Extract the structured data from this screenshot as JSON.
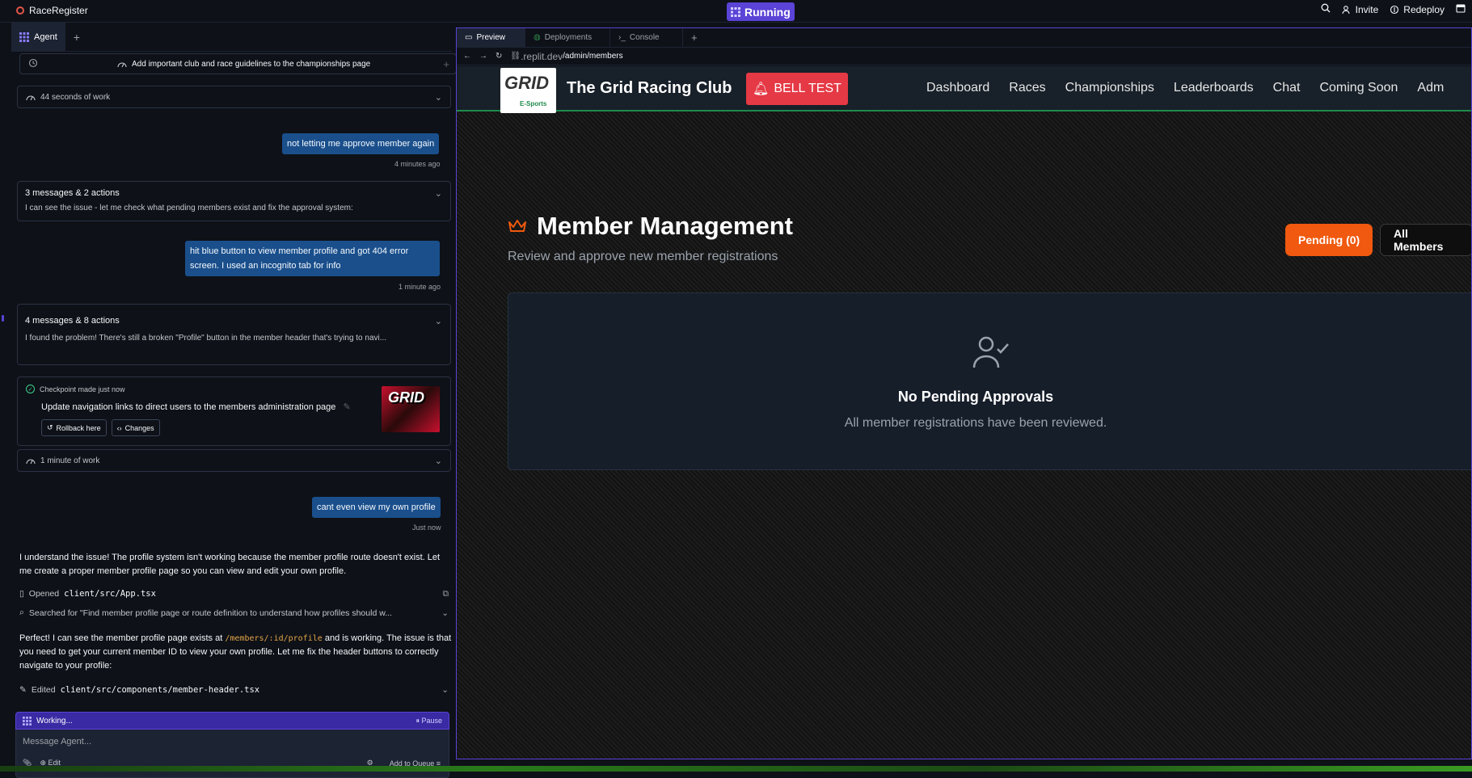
{
  "app": {
    "project_name": "RaceRegister",
    "status": "Running",
    "invite_label": "Invite",
    "redeploy_label": "Redeploy"
  },
  "agent_panel": {
    "tab_label": "Agent",
    "history_title": "Add important club and race guidelines to the championships page",
    "work1": "44 seconds of work",
    "msg1": "not letting me approve member again",
    "msg1_time": "4 minutes ago",
    "summary1_header": "3 messages & 2 actions",
    "summary1_text": "I can see the issue - let me check what pending members exist and fix the approval system:",
    "msg2": "hit blue button to view member profile and got 404 error screen. I used an incognito tab for info",
    "msg2_time": "1 minute ago",
    "summary2_header": "4 messages & 8 actions",
    "summary2_text": "I found the problem! There's still a broken \"Profile\" button in the member header that's trying to navi...",
    "checkpoint_label": "Checkpoint made just now",
    "checkpoint_title": "Update navigation links to direct users to the members administration page",
    "rollback_label": "Rollback here",
    "changes_label": "Changes",
    "thumb_text": "GRID",
    "work2": "1 minute of work",
    "msg3": "cant even view my own profile",
    "msg3_time": "Just now",
    "reply1": "I understand the issue! The profile system isn't working because the member profile route doesn't exist. Let me create a proper member profile page so you can view and edit your own profile.",
    "opened_label": "Opened",
    "opened_file": "client/src/App.tsx",
    "searched_text": "Searched for \"Find member profile page or route definition to understand how profiles should w...",
    "reply2_a": "Perfect! I can see the member profile page exists at",
    "reply2_code": "/members/:id/profile",
    "reply2_b": "and is working. The issue is that you need to get your current member ID to view your own profile. Let me fix the header buttons to correctly navigate to your profile:",
    "edited_label": "Edited",
    "edited_file": "client/src/components/member-header.tsx",
    "working_label": "Working...",
    "pause_label": "Pause",
    "input_placeholder": "Message Agent...",
    "edit_label": "Edit",
    "queue_label": "Add to Queue"
  },
  "preview_pane": {
    "tabs": [
      "Preview",
      "Deployments",
      "Console"
    ],
    "url_domain": ".replit.dev",
    "url_path": "/admin/members"
  },
  "site": {
    "logo_text": "GRID",
    "logo_sub": "E-Sports",
    "brand": "The Grid Racing Club",
    "bell_label": "BELL TEST",
    "nav": [
      "Dashboard",
      "Races",
      "Championships",
      "Leaderboards",
      "Chat",
      "Coming Soon",
      "Adm"
    ],
    "page_title": "Member Management",
    "page_subtitle": "Review and approve new member registrations",
    "pending_button": "Pending (0)",
    "all_button": "All Members",
    "empty_title": "No Pending Approvals",
    "empty_text": "All member registrations have been reviewed."
  },
  "colors": {
    "accent": "#5a43d6",
    "user_bubble": "#1a4f8c",
    "bell": "#e53945",
    "pending": "#f0590f",
    "crown": "#f0590f"
  }
}
